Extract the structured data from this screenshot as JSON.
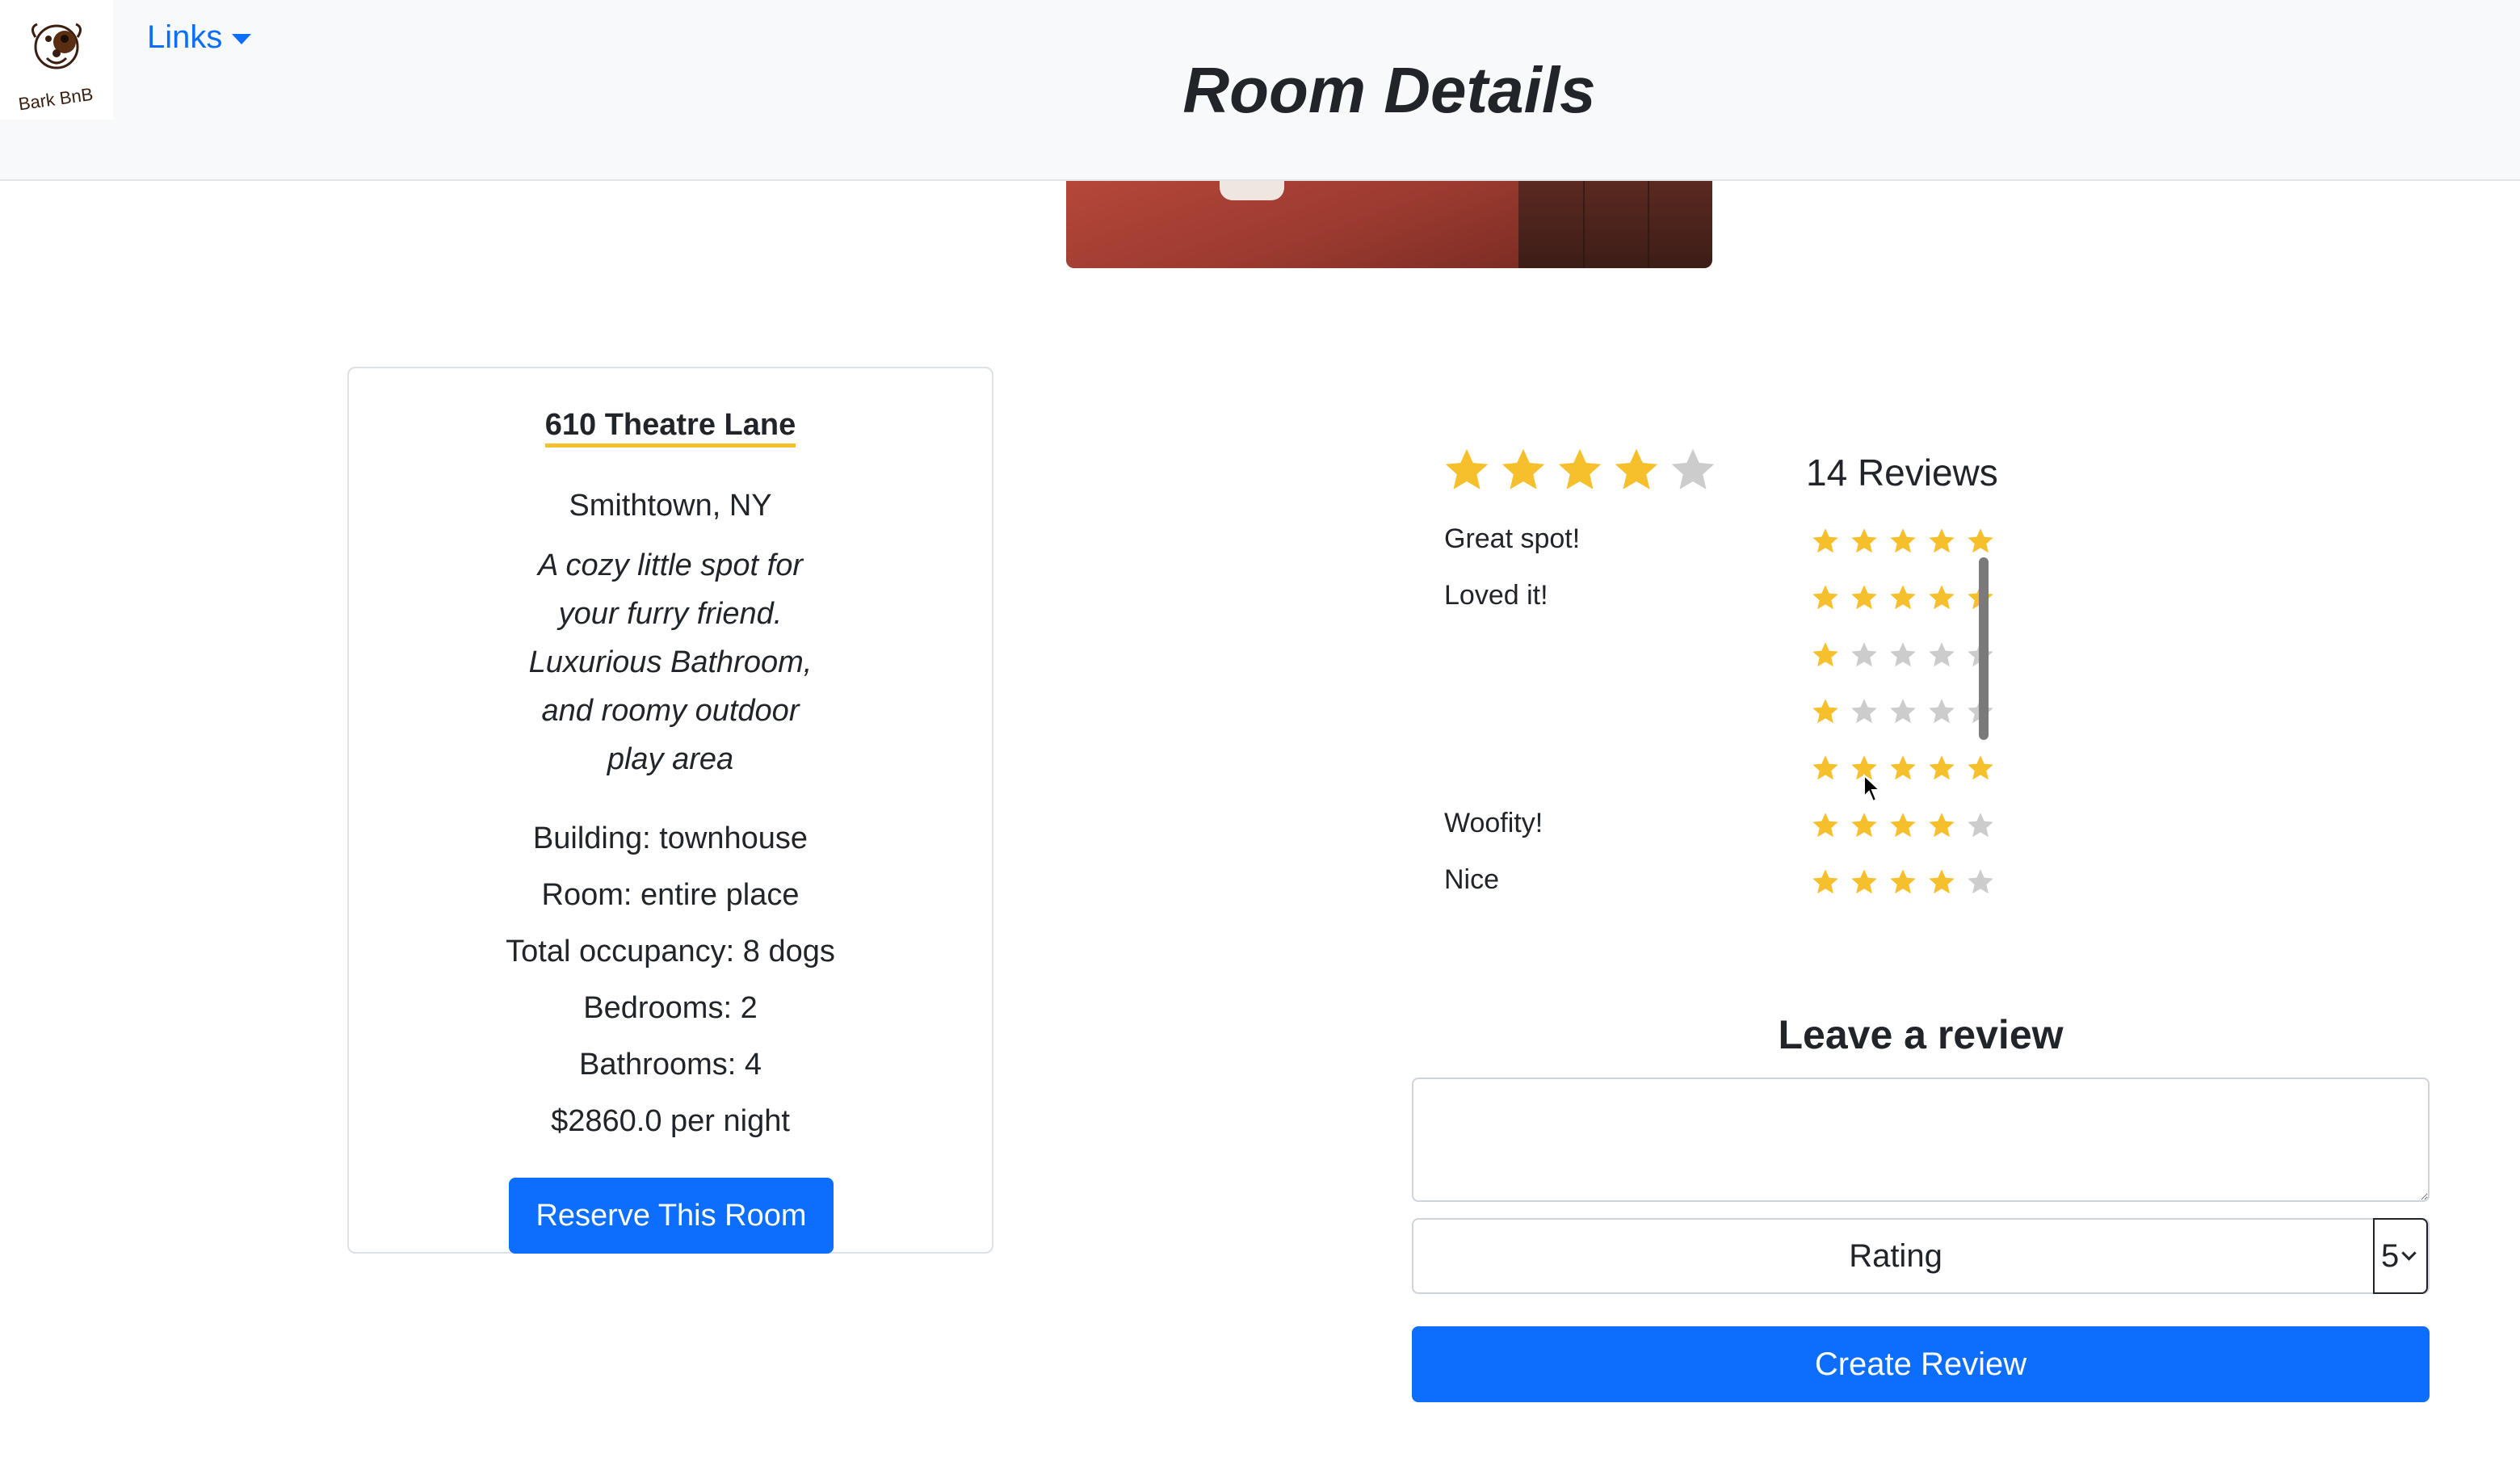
{
  "header": {
    "logo_text": "Bark BnB",
    "links_label": "Links",
    "page_title": "Room Details"
  },
  "room": {
    "address": "610 Theatre Lane",
    "city": "Smithtown, NY",
    "description_lines": [
      "A cozy little spot for",
      "your furry friend.",
      "Luxurious Bathroom,",
      "and roomy outdoor",
      "play area"
    ],
    "building": "Building: townhouse",
    "room_type": "Room: entire place",
    "occupancy": "Total occupancy: 8 dogs",
    "bedrooms": "Bedrooms: 2",
    "bathrooms": "Bathrooms: 4",
    "price": "$2860.0 per night",
    "reserve_label": "Reserve This Room"
  },
  "reviews": {
    "average_rating": 4,
    "max_rating": 5,
    "count_label": "14 Reviews",
    "items": [
      {
        "text": "Great spot!",
        "rating": 5
      },
      {
        "text": "Loved it!",
        "rating": 5
      },
      {
        "text": "",
        "rating": 1
      },
      {
        "text": "",
        "rating": 1
      },
      {
        "text": "",
        "rating": 5
      },
      {
        "text": "Woofity!",
        "rating": 4
      },
      {
        "text": "Nice",
        "rating": 4
      }
    ]
  },
  "leave_review": {
    "title": "Leave a review",
    "text_value": "",
    "rating_label": "Rating",
    "rating_value": "5",
    "create_label": "Create Review"
  },
  "colors": {
    "star_filled": "#f6c02c",
    "star_empty": "#cccccc",
    "primary": "#0d6efd"
  },
  "icons": [
    "bark-bnb-logo",
    "star-icon",
    "caret-down-icon",
    "chevron-down-icon",
    "mouse-cursor-icon"
  ]
}
